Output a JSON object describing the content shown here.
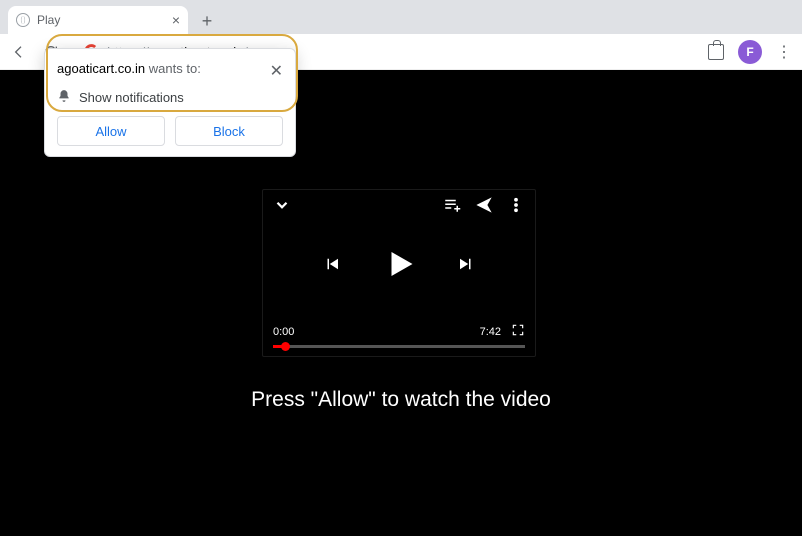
{
  "tab": {
    "title": "Play"
  },
  "address": {
    "scheme": "https://",
    "host": "agoaticart.co.in",
    "path": "/"
  },
  "avatar": {
    "letter": "F"
  },
  "prompt": {
    "site": "agoaticart.co.in",
    "wants_to": " wants to:",
    "permission": "Show notifications",
    "allow": "Allow",
    "block": "Block"
  },
  "player": {
    "current_time": "0:00",
    "duration": "7:42"
  },
  "caption": "Press \"Allow\" to watch the video"
}
